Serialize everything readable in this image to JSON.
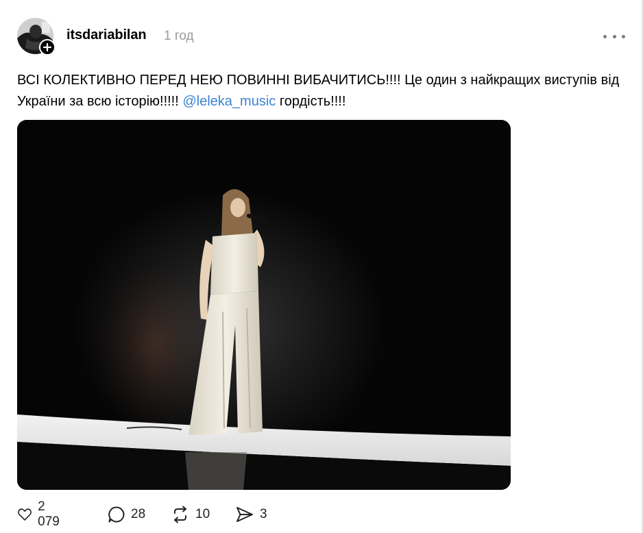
{
  "post": {
    "author": {
      "username": "itsdariabilan",
      "time": "1 год"
    },
    "text": {
      "main": "ВСІ КОЛЕКТИВНО ПЕРЕД НЕЮ ПОВИННІ ВИБАЧИТИСЬ!!!! Це один з найкращих виступів від України за всю історію!!!!! ",
      "mention": "@leleka_music",
      "tail": " гордість!!!!"
    },
    "stats": {
      "likes": "2 079",
      "replies": "28",
      "reposts": "10",
      "shares": "3"
    },
    "icons": {
      "like": "heart-icon",
      "reply": "speech-bubble-icon",
      "repost": "repost-icon",
      "share": "send-icon",
      "more": "more-horizontal-icon",
      "follow": "plus-icon"
    },
    "colors": {
      "mention": "#3b82d6",
      "timestamp": "#9a9a9a",
      "photo_background": "#050505"
    }
  }
}
